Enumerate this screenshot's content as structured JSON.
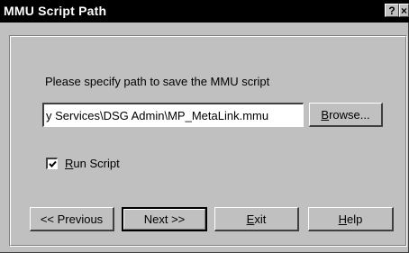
{
  "window": {
    "title": "MMU Script Path",
    "help_button": "?",
    "close_button": "×"
  },
  "form": {
    "prompt": "Please specify path to save the MMU script",
    "path_value": "y Services\\DSG Admin\\MP_MetaLink.mmu",
    "browse": {
      "mnemonic": "B",
      "rest": "rowse..."
    },
    "run_script": {
      "label_mnemonic": "R",
      "label_rest": "un Script",
      "checked": true
    }
  },
  "buttons": {
    "previous": "<< Previous",
    "next": "Next >>",
    "exit": {
      "mnemonic": "E",
      "rest": "xit"
    },
    "help": {
      "mnemonic": "H",
      "rest": "elp"
    }
  }
}
